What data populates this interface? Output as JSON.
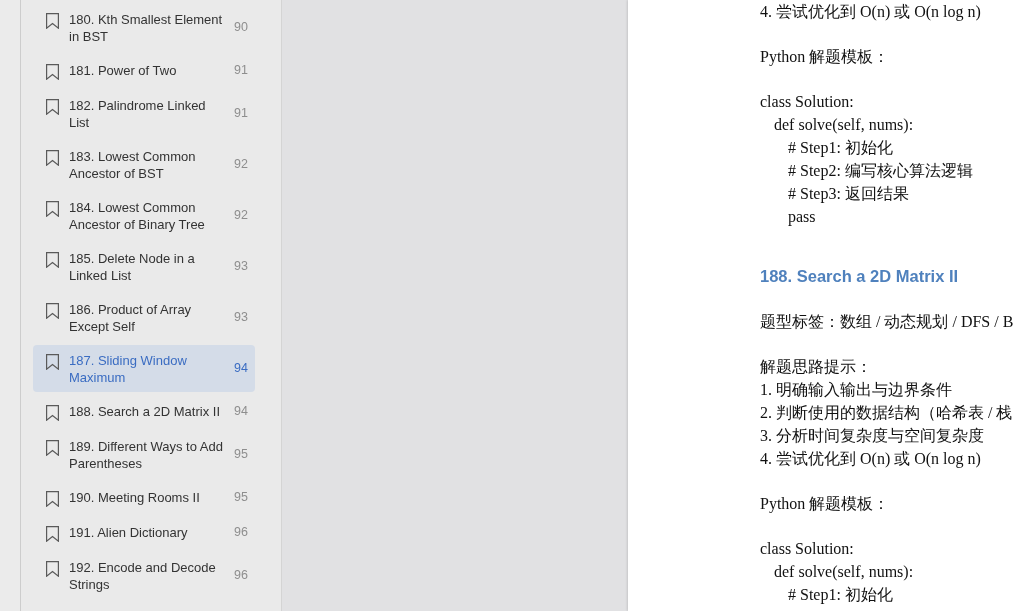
{
  "sidebar": {
    "items": [
      {
        "title": "180. Kth Smallest Element in BST",
        "page": "90",
        "selected": false
      },
      {
        "title": "181. Power of Two",
        "page": "91",
        "selected": false
      },
      {
        "title": "182. Palindrome Linked List",
        "page": "91",
        "selected": false
      },
      {
        "title": "183. Lowest Common Ancestor of BST",
        "page": "92",
        "selected": false
      },
      {
        "title": "184. Lowest Common Ancestor of Binary Tree",
        "page": "92",
        "selected": false
      },
      {
        "title": "185. Delete Node in a Linked List",
        "page": "93",
        "selected": false
      },
      {
        "title": "186. Product of Array Except Self",
        "page": "93",
        "selected": false
      },
      {
        "title": "187. Sliding Window Maximum",
        "page": "94",
        "selected": true
      },
      {
        "title": "188. Search a 2D Matrix II",
        "page": "94",
        "selected": false
      },
      {
        "title": "189. Different Ways to Add Parentheses",
        "page": "95",
        "selected": false
      },
      {
        "title": "190. Meeting Rooms II",
        "page": "95",
        "selected": false
      },
      {
        "title": "191. Alien Dictionary",
        "page": "96",
        "selected": false
      },
      {
        "title": "192. Encode and Decode Strings",
        "page": "96",
        "selected": false
      }
    ]
  },
  "document": {
    "blocks": [
      {
        "kind": "paragraph",
        "lines": [
          "4. 尝试优化到 O(n) 或 O(n log n)"
        ]
      },
      {
        "kind": "paragraph",
        "lines": [
          "Python 解题模板："
        ]
      },
      {
        "kind": "code",
        "lines": [
          {
            "text": "class Solution:",
            "children": [
              {
                "text": "def solve(self, nums):",
                "children": [
                  {
                    "text": "# Step1: 初始化"
                  },
                  {
                    "text": "# Step2: 编写核心算法逻辑"
                  },
                  {
                    "text": "# Step3: 返回结果"
                  },
                  {
                    "text": "pass"
                  }
                ]
              }
            ]
          }
        ]
      },
      {
        "kind": "heading",
        "text": "188. Search a 2D Matrix II"
      },
      {
        "kind": "paragraph",
        "lines": [
          "题型标签：数组 / 动态规划 / DFS / B"
        ]
      },
      {
        "kind": "paragraph",
        "lines": [
          "解题思路提示：",
          "1. 明确输入输出与边界条件",
          "2. 判断使用的数据结构（哈希表 / 栈",
          "3. 分析时间复杂度与空间复杂度",
          "4. 尝试优化到 O(n) 或 O(n log n)"
        ]
      },
      {
        "kind": "paragraph",
        "lines": [
          "Python 解题模板："
        ]
      },
      {
        "kind": "code",
        "lines": [
          {
            "text": "class Solution:",
            "children": [
              {
                "text": "def solve(self, nums):",
                "children": [
                  {
                    "text": "# Step1: 初始化"
                  }
                ]
              }
            ]
          }
        ]
      }
    ]
  }
}
